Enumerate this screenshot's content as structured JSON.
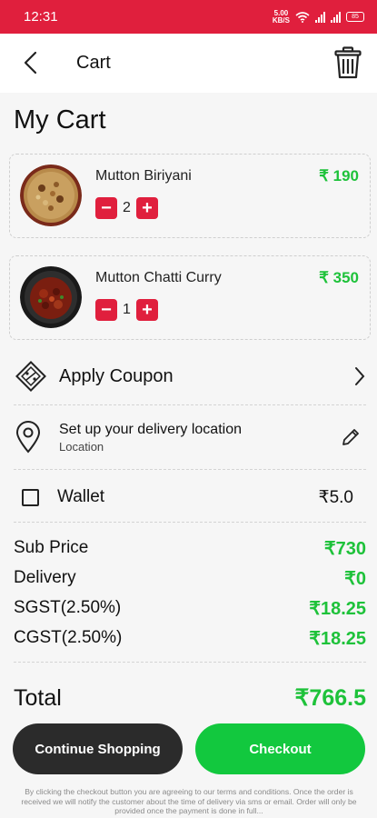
{
  "status_bar": {
    "time": "12:31",
    "network": "5.00\nKB/S",
    "battery": "85"
  },
  "app_bar": {
    "title": "Cart"
  },
  "page": {
    "title": "My Cart"
  },
  "cart_items": [
    {
      "name": "Mutton Biriyani",
      "price": "₹ 190",
      "qty": "2"
    },
    {
      "name": "Mutton Chatti Curry",
      "price": "₹ 350",
      "qty": "1"
    }
  ],
  "coupon": {
    "label": "Apply Coupon"
  },
  "location": {
    "title": "Set up your delivery location",
    "subtitle": "Location"
  },
  "wallet": {
    "label": "Wallet",
    "amount": "₹5.0",
    "checked": false
  },
  "summary": [
    {
      "label": "Sub Price",
      "value": "₹730"
    },
    {
      "label": "Delivery",
      "value": "₹0"
    },
    {
      "label": "SGST(2.50%)",
      "value": "₹18.25"
    },
    {
      "label": "CGST(2.50%)",
      "value": "₹18.25"
    }
  ],
  "total": {
    "label": "Total",
    "value": "₹766.5"
  },
  "buttons": {
    "continue": "Continue Shopping",
    "checkout": "Checkout"
  },
  "note": "By clicking the checkout button you are agreeing to our terms and conditions. Once the order is received we will notify the customer about the time of delivery via sms or email. Order will only be provided once the payment is done in full...",
  "colors": {
    "accent_red": "#e01f3d",
    "price_green": "#1ec23a",
    "checkout_green": "#12c83e",
    "dark_button": "#2b2b2b"
  }
}
